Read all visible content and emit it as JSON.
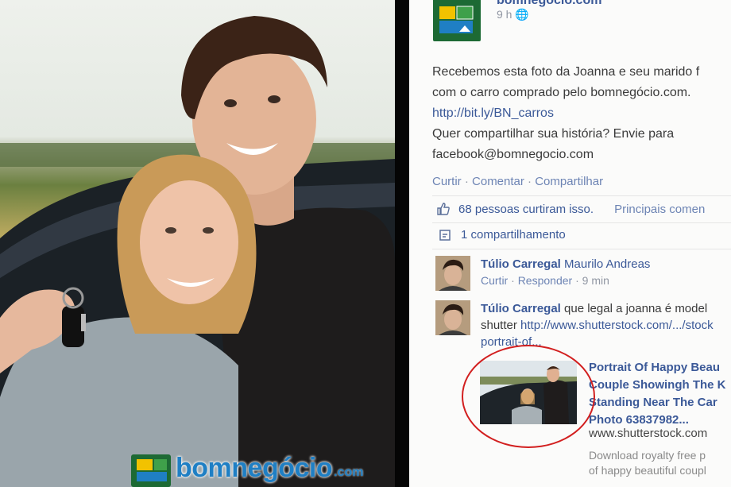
{
  "photo": {
    "watermark_brand": "bomnegócio",
    "watermark_suffix": ".com"
  },
  "post": {
    "page_name": "bomnegócio.com",
    "time": "9 h",
    "text_line1": "Recebemos esta foto da Joanna e seu marido f",
    "text_line2": "com o carro comprado pelo bomnegócio.com.",
    "link": "http://bit.ly/BN_carros",
    "text_line3": "Quer compartilhar sua história? Envie para",
    "email": "facebook@bomnegocio.com",
    "actions": [
      "Curtir",
      "Comentar",
      "Compartilhar"
    ],
    "likes": "68 pessoas curtiram isso.",
    "top_comments": "Principais comen",
    "shares": "1 compartilhamento"
  },
  "comments": [
    {
      "author": "Túlio Carregal",
      "text": "Maurilo Andreas",
      "like": "Curtir",
      "reply": "Responder",
      "time": "9 min"
    },
    {
      "author": "Túlio Carregal",
      "text": "que legal a joanna é model",
      "line2_prefix": "shutter",
      "line2_link": "http://www.shutterstock.com/.../stock",
      "line3_link": "portrait-of..."
    }
  ],
  "link_preview": {
    "title_lines": [
      "Portrait Of Happy Beau",
      "Couple Showingh The K",
      "Standing Near The Car",
      "Photo 63837982..."
    ],
    "domain": "www.shutterstock.com",
    "desc_lines": [
      "Download royalty free p",
      "of happy beautiful coupl"
    ]
  },
  "colors": {
    "facebook_blue": "#3b5998",
    "brand_green": "#1d6a34",
    "annotation_red": "#d21f1f"
  }
}
